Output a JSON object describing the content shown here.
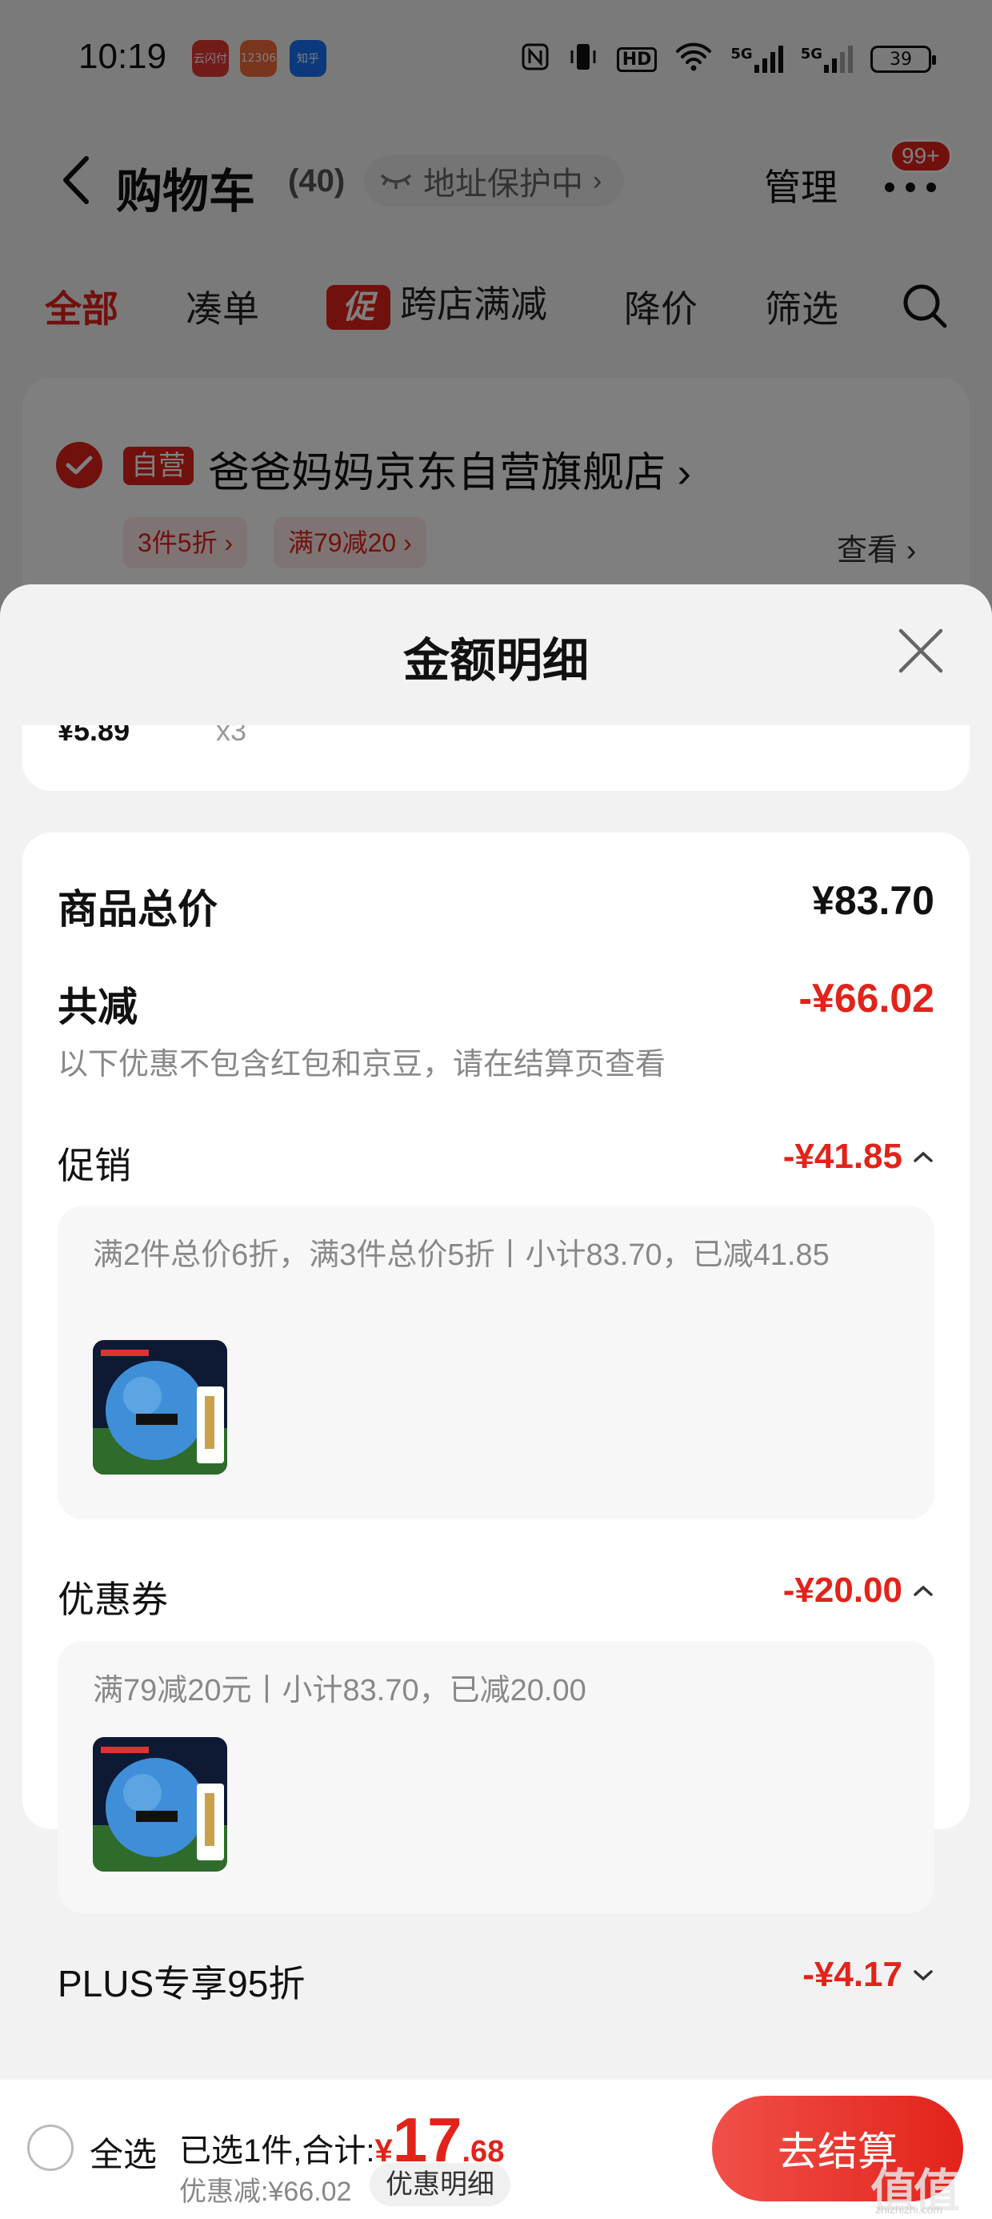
{
  "status_bar": {
    "time": "10:19",
    "apps": [
      {
        "name": "alipay-icon",
        "label": "云闪付",
        "color": "#e53935"
      },
      {
        "name": "railway-12306-icon",
        "label": "12306",
        "color": "#f26c3b"
      },
      {
        "name": "zhihu-icon",
        "label": "知乎",
        "color": "#1772f6"
      }
    ],
    "hd_label": "HD",
    "net1": "5G",
    "net2": "5G",
    "battery": "39"
  },
  "nav": {
    "title": "购物车",
    "count": "(40)",
    "address_protect": "地址保护中",
    "manage": "管理",
    "badge": "99+"
  },
  "tabs": {
    "all": "全部",
    "bundle": "凑单",
    "promo_tag": "促",
    "cross_store": "跨店满减",
    "price_drop": "降价",
    "filter": "筛选"
  },
  "store": {
    "self_tag": "自营",
    "name": "爸爸妈妈京东自营旗舰店",
    "chip1": "3件5折",
    "chip2": "满79减20",
    "view": "查看"
  },
  "sheet": {
    "title": "金额明细",
    "partial_price": "¥5.89",
    "partial_qty": "x3",
    "total_label": "商品总价",
    "total_value": "¥83.70",
    "reduce_label": "共减",
    "reduce_value": "-¥66.02",
    "reduce_note": "以下优惠不包含红包和京豆，请在结算页查看",
    "promo_label": "促销",
    "promo_value": "-¥41.85",
    "promo_detail": "满2件总价6折，满3件总价5折丨小计83.70，已减41.85",
    "coupon_label": "优惠券",
    "coupon_value": "-¥20.00",
    "coupon_detail": "满79减20元丨小计83.70，已减20.00",
    "plus_label": "PLUS专享95折",
    "plus_value": "-¥4.17"
  },
  "bottom": {
    "select_all": "全选",
    "selected_text": "已选1件,合计:",
    "yen": "¥",
    "total_int": "17",
    "total_dec": ".68",
    "discount_text": "优惠减:¥66.02",
    "detail_btn": "优惠明细",
    "checkout": "去结算",
    "watermark": "值值值",
    "watermark_sub": "zhizhizhi.com"
  },
  "colors": {
    "accent": "#e2231a",
    "text_muted": "#888888"
  }
}
